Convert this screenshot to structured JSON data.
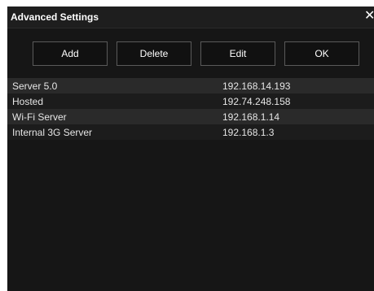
{
  "window": {
    "title": "Advanced Settings",
    "close_glyph": "✕"
  },
  "toolbar": {
    "add_label": "Add",
    "delete_label": "Delete",
    "edit_label": "Edit",
    "ok_label": "OK"
  },
  "servers": [
    {
      "name": "Server 5.0",
      "ip": "192.168.14.193"
    },
    {
      "name": "Hosted",
      "ip": "192.74.248.158"
    },
    {
      "name": "Wi-Fi Server",
      "ip": "192.168.1.14"
    },
    {
      "name": "Internal 3G Server",
      "ip": "192.168.1.3"
    }
  ],
  "colors": {
    "background": "#161616",
    "row_alt": "#2a2a2a",
    "text": "#ffffff"
  }
}
